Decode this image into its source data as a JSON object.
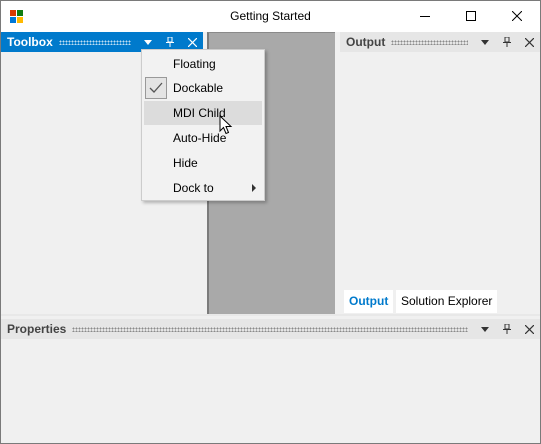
{
  "window": {
    "title": "Getting Started"
  },
  "toolbox": {
    "title": "Toolbox"
  },
  "output": {
    "title": "Output",
    "tabs": [
      {
        "label": "Output",
        "active": true
      },
      {
        "label": "Solution Explorer",
        "active": false
      }
    ]
  },
  "properties": {
    "title": "Properties"
  },
  "context_menu": {
    "items": [
      {
        "label": "Floating",
        "checked": false,
        "hover": false,
        "submenu": false
      },
      {
        "label": "Dockable",
        "checked": true,
        "hover": false,
        "submenu": false
      },
      {
        "label": "MDI Child",
        "checked": false,
        "hover": true,
        "submenu": false
      },
      {
        "label": "Auto-Hide",
        "checked": false,
        "hover": false,
        "submenu": false
      },
      {
        "label": "Hide",
        "checked": false,
        "hover": false,
        "submenu": false
      },
      {
        "label": "Dock to",
        "checked": false,
        "hover": false,
        "submenu": true
      }
    ]
  },
  "icons": {
    "app": "app-icon",
    "minimize": "minimize-icon",
    "maximize": "maximize-icon",
    "close": "close-icon",
    "dropdown": "chevron-down-icon",
    "pin": "pin-icon",
    "panel_close": "close-icon",
    "check": "check-icon",
    "submenu": "chevron-right-icon",
    "cursor": "cursor-icon"
  },
  "colors": {
    "active_header": "#007acc",
    "inactive_header": "#e6e6e6",
    "document_area": "#a9a9a9",
    "active_tab_text": "#007acc",
    "window_background": "#f0f0f0"
  }
}
